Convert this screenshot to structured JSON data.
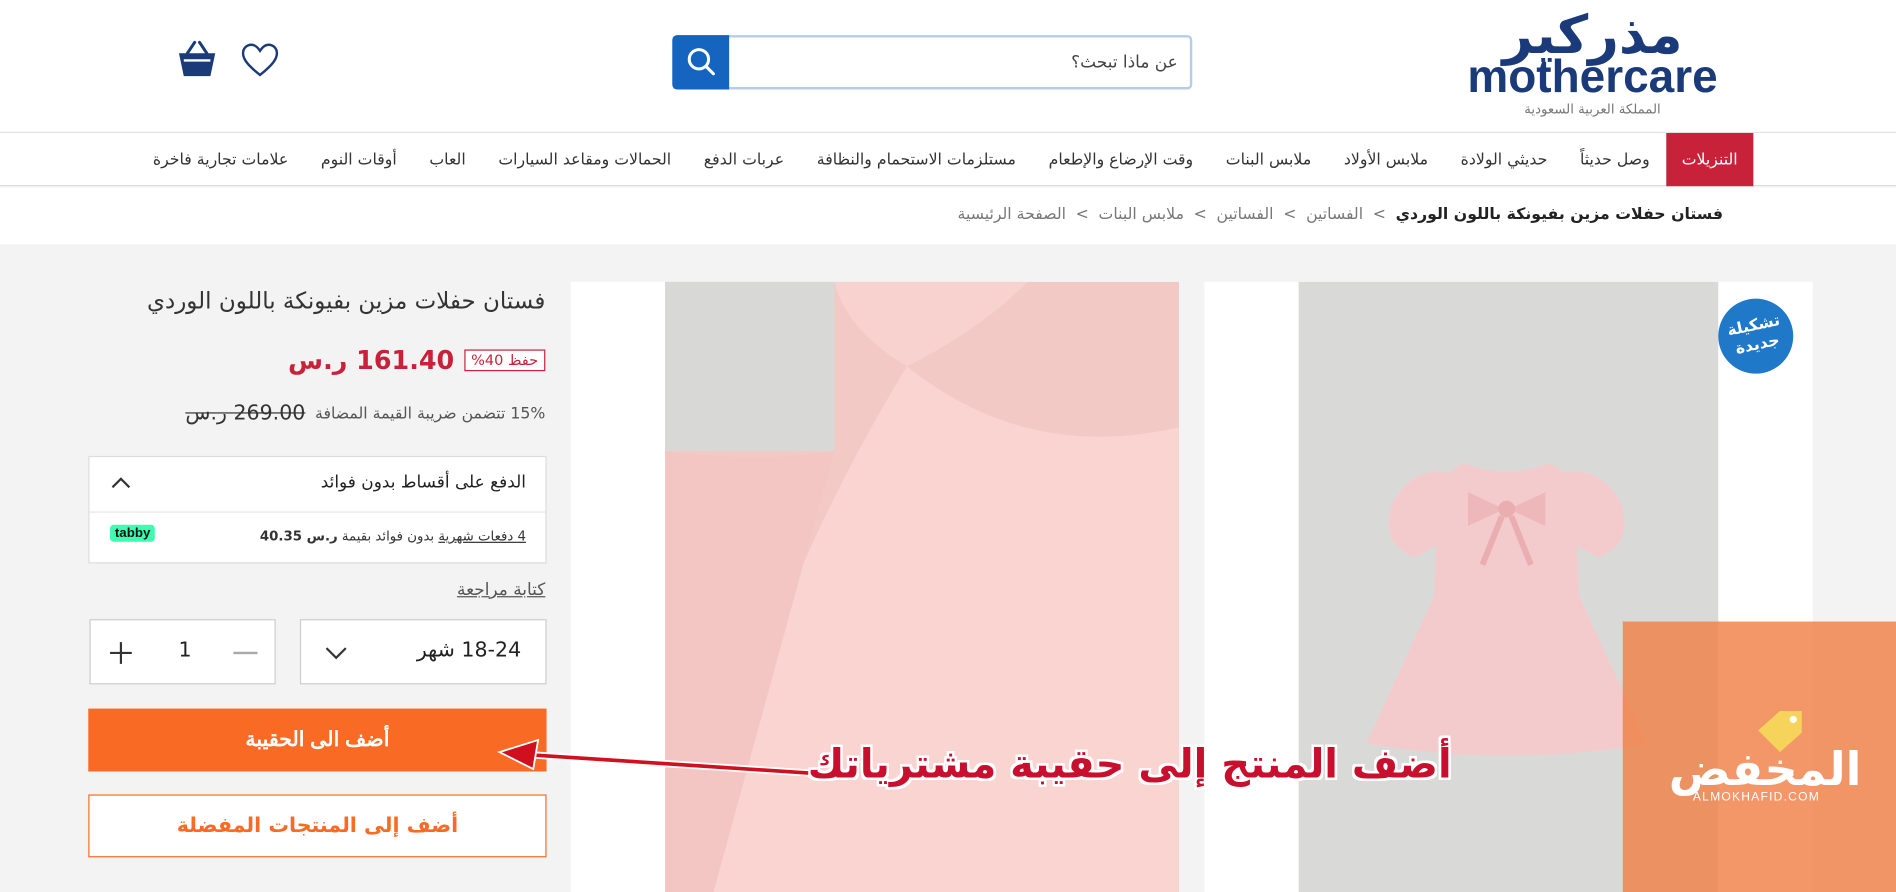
{
  "header": {
    "logo_ar": "مذركير",
    "logo_en": "mothercare",
    "logo_sub": "المملكة العربية السعودية",
    "search_placeholder": "عن ماذا تبحث؟"
  },
  "nav": {
    "items": [
      "التنزيلات",
      "وصل حديثاً",
      "حديثي الولادة",
      "ملابس الأولاد",
      "ملابس البنات",
      "وقت الإرضاع والإطعام",
      "مستلزمات الاستحمام والنظافة",
      "عربات الدفع",
      "الحمالات ومقاعد السيارات",
      "العاب",
      "أوقات النوم",
      "علامات تجارية فاخرة"
    ]
  },
  "breadcrumb": {
    "items": [
      "الصفحة الرئيسية",
      "ملابس البنات",
      "الفساتين",
      "الفساتين",
      "فستان حفلات مزين بفيونكة باللون الوردي"
    ],
    "separator": ">"
  },
  "product": {
    "badge": "تشكيلة جديدة",
    "title": "فستان حفلات مزين بفيونكة باللون الوردي",
    "price": "161.40 ر.س",
    "discount": "حفظ 40%",
    "old_price": "269.00 ر.س",
    "vat_note": "15% تتضمن ضريبة القيمة المضافة",
    "installments_title": "الدفع على أقساط بدون فوائد",
    "tabby_link": "4 دفعات شهرية",
    "tabby_text": " بدون فوائد بقيمة ",
    "tabby_amount": "ر.س 40.35",
    "tabby_logo": "tabby",
    "review_link": "كتابة مراجعة",
    "size": "18-24 شهر",
    "quantity": "1",
    "add_to_bag": "أضف الى الحقيبة",
    "add_to_wishlist": "أضف إلى المنتجات المفضلة"
  },
  "overlay": {
    "annotation": "أضف المنتج إلى حقيبة مشترياتك",
    "watermark": "المخفض",
    "watermark_sub": "ALMOKHAFID.COM"
  },
  "colors": {
    "brand_blue": "#1a3a7a",
    "sale_red": "#c8223a",
    "cta_orange": "#f96b25",
    "search_blue": "#1565c0"
  }
}
